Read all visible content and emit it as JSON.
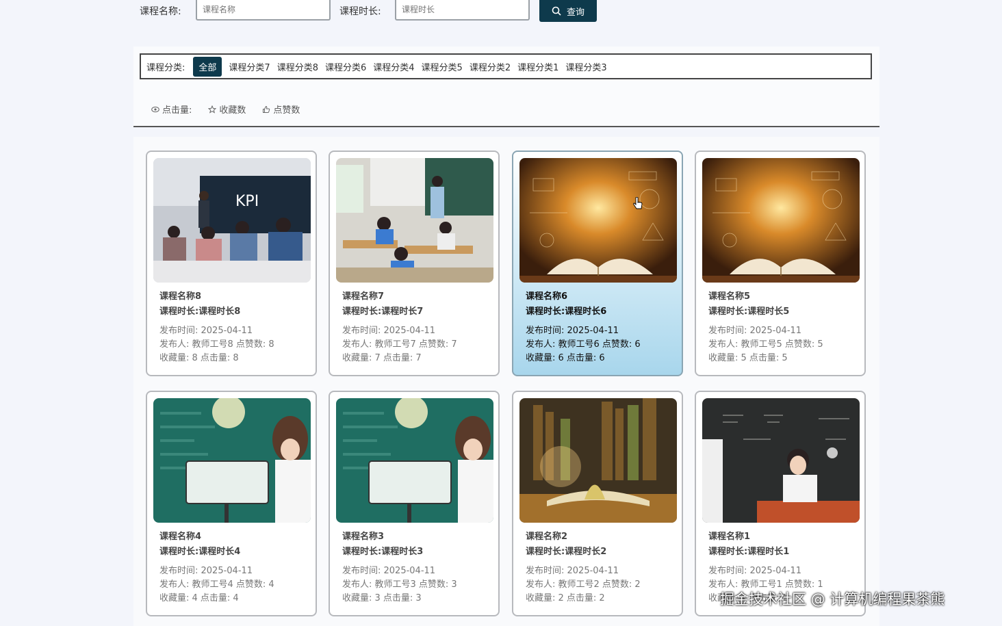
{
  "search": {
    "name_label": "课程名称:",
    "name_placeholder": "课程名称",
    "duration_label": "课程时长:",
    "duration_placeholder": "课程时长",
    "button_label": "查询"
  },
  "categories": {
    "label": "课程分类:",
    "items": [
      "全部",
      "课程分类7",
      "课程分类8",
      "课程分类6",
      "课程分类4",
      "课程分类5",
      "课程分类2",
      "课程分类1",
      "课程分类3"
    ],
    "active": "全部"
  },
  "sort": {
    "clicks": "点击量:",
    "favorites": "收藏数",
    "likes": "点赞数"
  },
  "cards": [
    {
      "name": "课程名称8",
      "duration": "课程时长:课程时长8",
      "publish": "发布时间:  2025-04-11",
      "publisher": "发布人:  教师工号8   点赞数:  8",
      "stats": "收藏量:  8   点击量:  8",
      "kpi": "KPI"
    },
    {
      "name": "课程名称7",
      "duration": "课程时长:课程时长7",
      "publish": "发布时间:  2025-04-11",
      "publisher": "发布人:  教师工号7   点赞数:  7",
      "stats": "收藏量:  7   点击量:  7"
    },
    {
      "name": "课程名称6",
      "duration": "课程时长:课程时长6",
      "publish": "发布时间:  2025-04-11",
      "publisher": "发布人:  教师工号6   点赞数:  6",
      "stats": "收藏量:  6   点击量:  6"
    },
    {
      "name": "课程名称5",
      "duration": "课程时长:课程时长5",
      "publish": "发布时间:  2025-04-11",
      "publisher": "发布人:  教师工号5   点赞数:  5",
      "stats": "收藏量:  5   点击量:  5"
    },
    {
      "name": "课程名称4",
      "duration": "课程时长:课程时长4",
      "publish": "发布时间:  2025-04-11",
      "publisher": "发布人:  教师工号4   点赞数:  4",
      "stats": "收藏量:  4   点击量:  4"
    },
    {
      "name": "课程名称3",
      "duration": "课程时长:课程时长3",
      "publish": "发布时间:  2025-04-11",
      "publisher": "发布人:  教师工号3   点赞数:  3",
      "stats": "收藏量:  3   点击量:  3"
    },
    {
      "name": "课程名称2",
      "duration": "课程时长:课程时长2",
      "publish": "发布时间:  2025-04-11",
      "publisher": "发布人:  教师工号2   点赞数:  2",
      "stats": "收藏量:  2   点击量:  2"
    },
    {
      "name": "课程名称1",
      "duration": "课程时长:课程时长1",
      "publish": "发布时间:  2025-04-11",
      "publisher": "发布人:  教师工号1   点赞数:  1",
      "stats": "收藏量:  1   点击量:  1"
    }
  ],
  "watermark": "掘金技术社区 @ 计算机编程果茶熊",
  "colors": {
    "accent": "#0e3a4c",
    "highlight_card": "#a8d6ec"
  }
}
